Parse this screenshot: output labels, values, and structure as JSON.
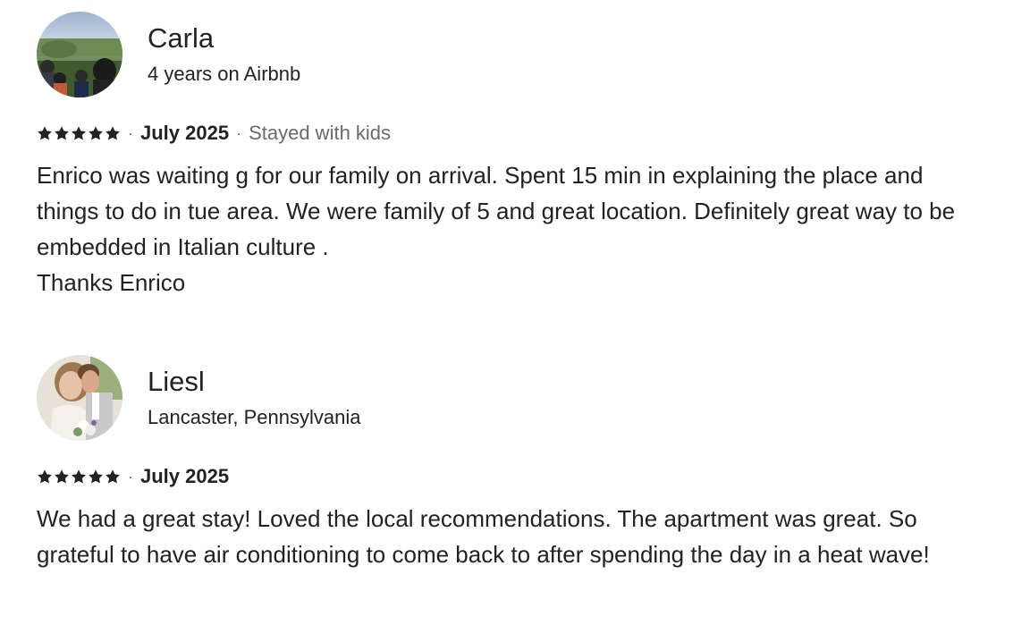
{
  "reviews": [
    {
      "name": "Carla",
      "subtitle": "4 years on Airbnb",
      "rating": 5,
      "date": "July 2025",
      "trip_type": "Stayed with kids",
      "paragraphs": [
        "Enrico was waiting g for our family on arrival.  Spent 15 min in explaining the place and things to do in tue area.  We were family of 5 and great location.  Definitely great way to be embedded in Italian culture .",
        "Thanks Enrico"
      ]
    },
    {
      "name": "Liesl",
      "subtitle": "Lancaster, Pennsylvania",
      "rating": 5,
      "date": "July 2025",
      "paragraphs": [
        "We had a great stay! Loved the local recommendations. The apartment was great. So grateful to have air conditioning to come back to after spending the day in a heat wave!"
      ]
    }
  ],
  "separator": "·",
  "icons": {
    "star": "star-icon",
    "avatar_carla": "avatar-photo",
    "avatar_liesl": "avatar-photo"
  },
  "colors": {
    "text_primary": "#222222",
    "text_secondary": "#6a6a6a",
    "star": "#222222"
  }
}
